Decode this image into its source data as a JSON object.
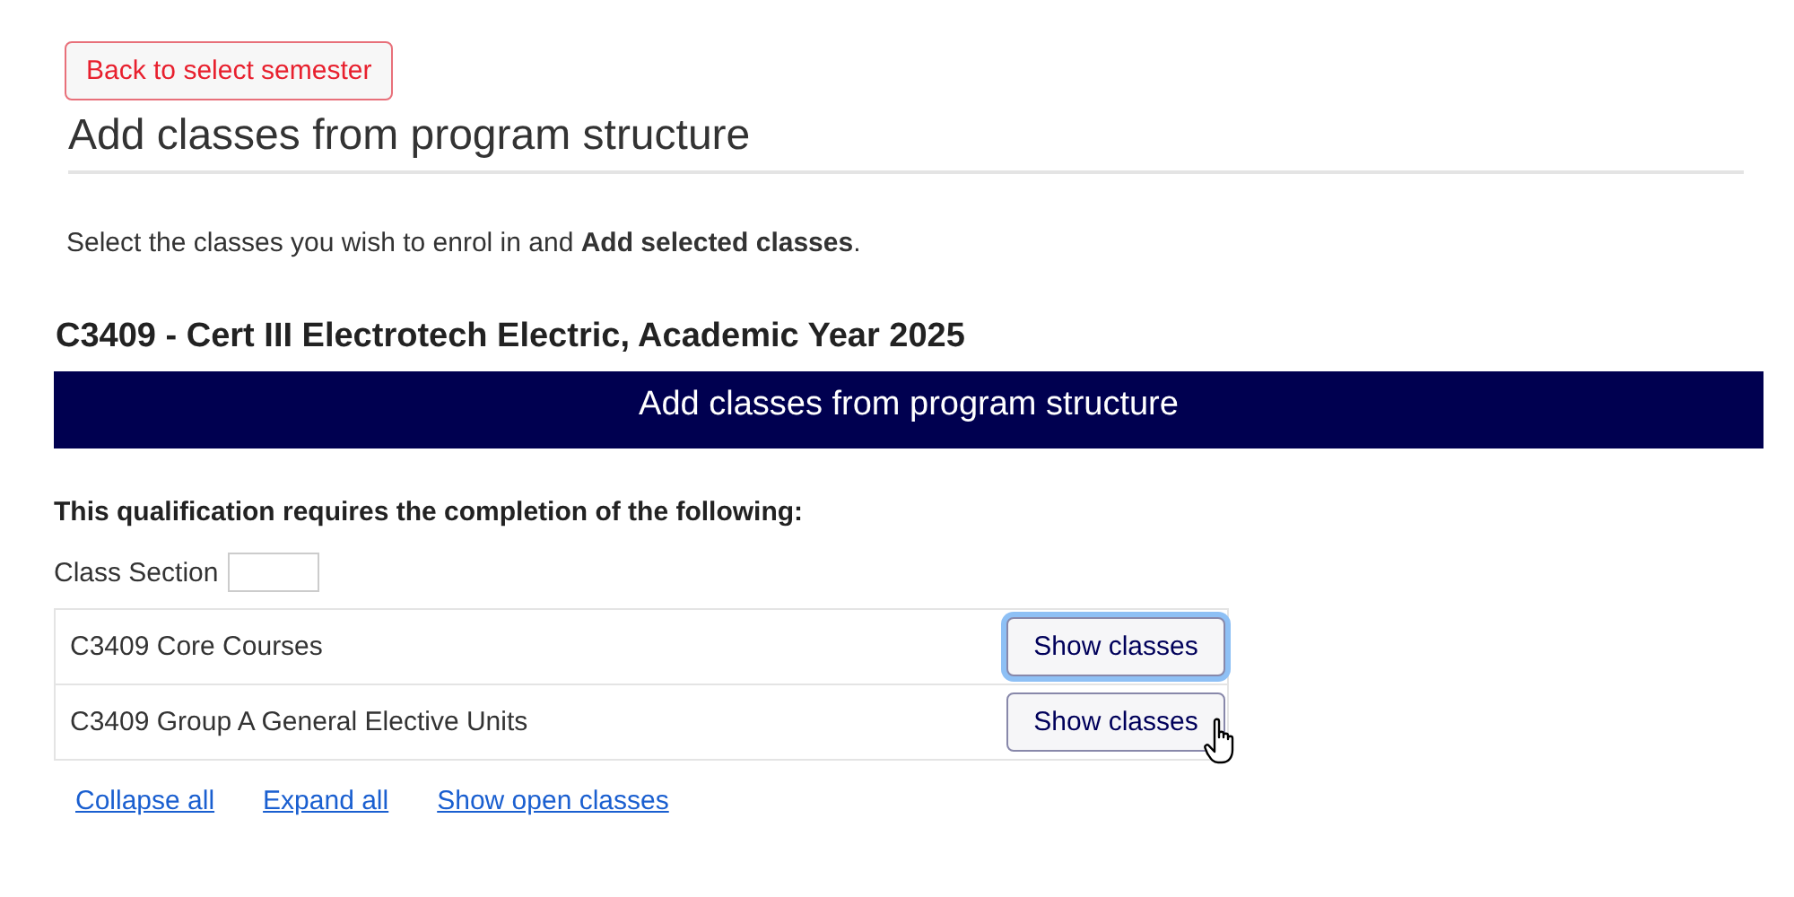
{
  "back_button": {
    "label": "Back to select semester"
  },
  "page_title": "Add classes from program structure",
  "instructions": "Select the classes you wish to enrol in and **Add selected classes**.",
  "program_heading": "C3409 - Cert III Electrotech Electric, Academic Year 2025",
  "banner": "Add classes from program structure",
  "requirement_text": "This qualification requires the completion of the following:",
  "class_section": {
    "label": "Class Section"
  },
  "groups": [
    {
      "name": "C3409 Core Courses",
      "button": "Show classes",
      "focused": true
    },
    {
      "name": "C3409 Group A General Elective Units",
      "button": "Show classes",
      "focused": false
    }
  ],
  "links": [
    "Collapse all",
    "Expand all",
    "Show open classes"
  ]
}
